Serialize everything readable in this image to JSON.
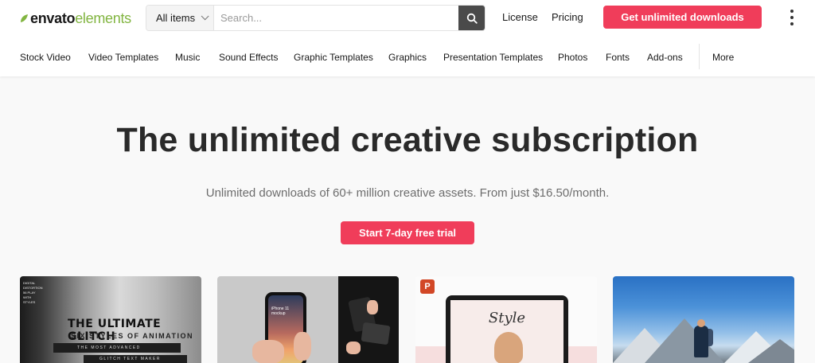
{
  "logo": {
    "brand": "envato",
    "product": "elements"
  },
  "search": {
    "category": "All items",
    "placeholder": "Search..."
  },
  "header_links": {
    "license": "License",
    "pricing": "Pricing"
  },
  "cta_label": "Get unlimited downloads",
  "nav": {
    "items": [
      "Stock Video",
      "Video Templates",
      "Music",
      "Sound Effects",
      "Graphic Templates",
      "Graphics",
      "Presentation Templates",
      "Photos",
      "Fonts",
      "Add-ons"
    ],
    "more": "More"
  },
  "hero": {
    "title": "The unlimited creative subscription",
    "subtitle": "Unlimited downloads of 60+ million creative assets. From just $16.50/month.",
    "button": "Start 7-day free trial"
  },
  "cards": {
    "glitch": {
      "title": "THE ULTIMATE GLITCH",
      "subtitle": "SIX STYLES OF ANIMATION",
      "bar1": "THE MOST ADVANCED",
      "bar2": "GLITCH TEXT MAKER",
      "tags": "DIGITAL DISTORTION 56 PLAY WITH STYLES"
    },
    "phone": {
      "screen_text": "iPhone 11 mockup"
    },
    "presentation": {
      "ppt_letter": "P",
      "word": "Style"
    }
  },
  "colors": {
    "accent": "#f03d5a",
    "brand_green": "#82b541"
  },
  "icons": {
    "search": "search-icon",
    "menu": "kebab-menu-icon",
    "ppt": "powerpoint-icon"
  }
}
